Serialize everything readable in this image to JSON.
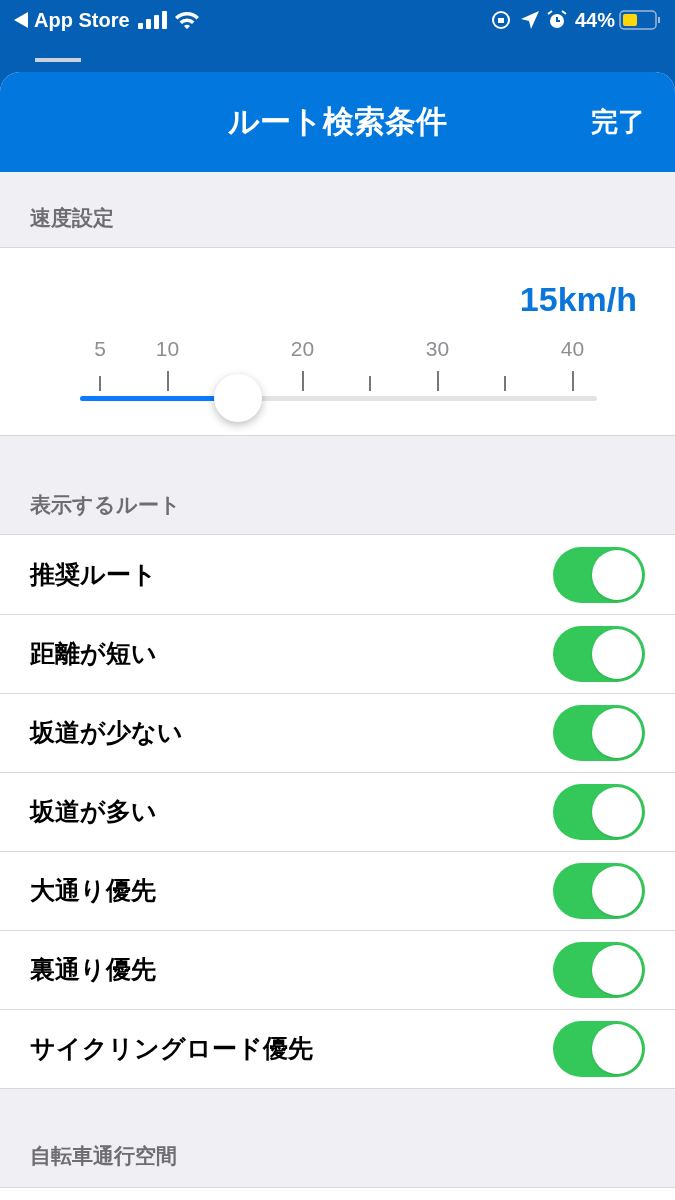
{
  "status_bar": {
    "back_label": "App Store",
    "battery": "44%"
  },
  "sheet": {
    "title": "ルート検索条件",
    "done": "完了"
  },
  "speed": {
    "header": "速度設定",
    "value": "15km/h",
    "level": 0.306,
    "ticks": [
      {
        "label": "5",
        "kind": "minor"
      },
      {
        "label": "10",
        "kind": "major"
      },
      {
        "label": "20",
        "kind": "major"
      },
      {
        "kind": "minor"
      },
      {
        "label": "30",
        "kind": "major"
      },
      {
        "kind": "minor"
      },
      {
        "label": "40",
        "kind": "major"
      }
    ]
  },
  "routes": {
    "header": "表示するルート",
    "items": [
      {
        "label": "推奨ルート",
        "on": true
      },
      {
        "label": "距離が短い",
        "on": true
      },
      {
        "label": "坂道が少ない",
        "on": true
      },
      {
        "label": "坂道が多い",
        "on": true
      },
      {
        "label": "大通り優先",
        "on": true
      },
      {
        "label": "裏通り優先",
        "on": true
      },
      {
        "label": "サイクリングロード優先",
        "on": true
      }
    ]
  },
  "bike_space": {
    "header": "自転車通行空間"
  }
}
